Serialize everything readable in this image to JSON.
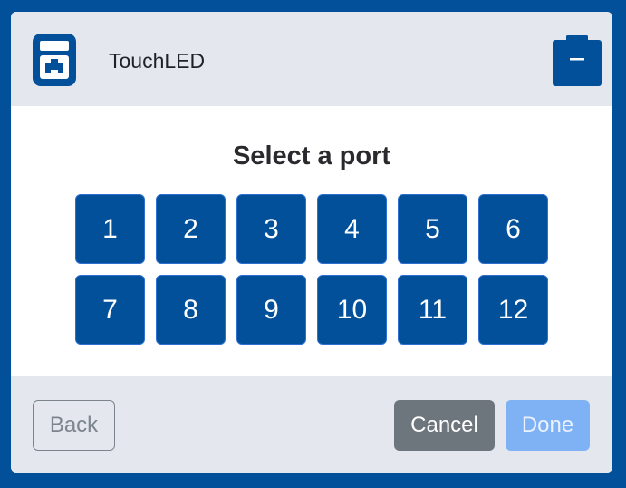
{
  "header": {
    "device_name": "TouchLED",
    "device_icon": "touchled-device-icon",
    "battery_icon": "battery-icon"
  },
  "main": {
    "prompt": "Select a port",
    "ports": [
      "1",
      "2",
      "3",
      "4",
      "5",
      "6",
      "7",
      "8",
      "9",
      "10",
      "11",
      "12"
    ]
  },
  "footer": {
    "back_label": "Back",
    "cancel_label": "Cancel",
    "done_label": "Done"
  },
  "colors": {
    "frame": "#02509a",
    "port_button": "#02509a",
    "cancel_button": "#6d757d",
    "done_button_disabled": "#7fb1f5",
    "header_footer_bg": "#e5e7ee"
  }
}
